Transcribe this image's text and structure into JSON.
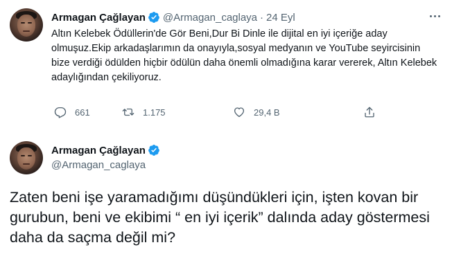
{
  "tweet1": {
    "author_name": "Armagan Çağlayan",
    "author_handle": "@Armagan_caglaya",
    "separator": "·",
    "date": "24 Eyl",
    "text": "Altın Kelebek Ödüllerin'de Gör Beni,Dur Bi Dinle ile dijital en iyi içeriğe aday olmuşuz.Ekip arkadaşlarımın da onayıyla,sosyal medyanın ve YouTube seyircisinin bize verdiği ödülden hiçbir ödülün daha önemli olmadığına karar vererek, Altın Kelebek adaylığından çekiliyoruz.",
    "reply_count": "661",
    "retweet_count": "1.175",
    "like_count": "29,4 B"
  },
  "tweet2": {
    "author_name": "Armagan Çağlayan",
    "author_handle": "@Armagan_caglaya",
    "text": "Zaten beni işe yaramadığımı düşündükleri için, işten kovan bir gurubun, beni ve ekibimi “ en iyi içerik” dalında aday göstermesi daha da saçma değil mi?"
  },
  "colors": {
    "verified_badge": "#1d9bf0",
    "secondary_text": "#536471",
    "primary_text": "#0f1419"
  },
  "icons": [
    "verified-badge-icon",
    "more-options-icon",
    "reply-icon",
    "retweet-icon",
    "like-icon",
    "share-icon"
  ]
}
